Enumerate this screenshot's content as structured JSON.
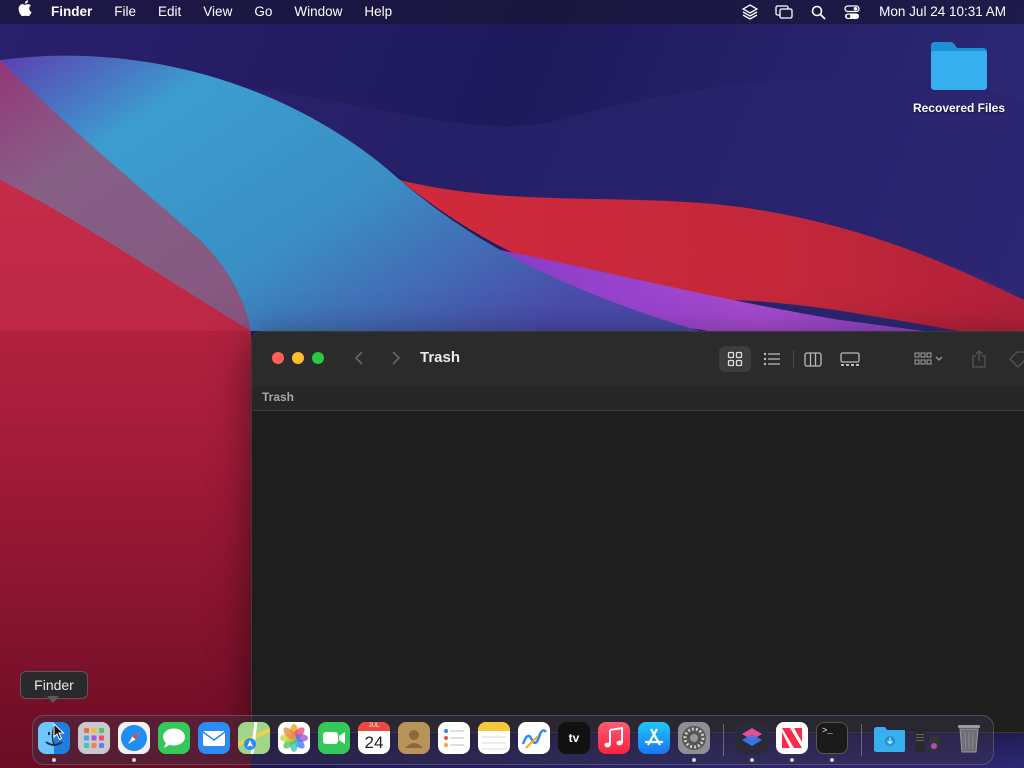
{
  "menubar": {
    "app_name": "Finder",
    "menus": [
      "File",
      "Edit",
      "View",
      "Go",
      "Window",
      "Help"
    ],
    "clock": "Mon Jul 24  10:31 AM",
    "status_icons": [
      "layers-icon",
      "screen-mirroring-icon",
      "search-icon",
      "control-center-icon"
    ]
  },
  "desktop": {
    "folder_label": "Recovered Files"
  },
  "finder_window": {
    "title": "Trash",
    "path_label": "Trash",
    "view_modes": [
      "icon-view",
      "list-view",
      "column-view",
      "gallery-view"
    ],
    "active_view": "icon-view"
  },
  "tooltip": {
    "text": "Finder"
  },
  "dock": {
    "apps": [
      {
        "name": "Finder",
        "running": true
      },
      {
        "name": "Launchpad",
        "running": false
      },
      {
        "name": "Safari",
        "running": true
      },
      {
        "name": "Messages",
        "running": false
      },
      {
        "name": "Mail",
        "running": false
      },
      {
        "name": "Maps",
        "running": false
      },
      {
        "name": "Photos",
        "running": false
      },
      {
        "name": "FaceTime",
        "running": false
      },
      {
        "name": "Calendar",
        "running": false
      },
      {
        "name": "Contacts",
        "running": false
      },
      {
        "name": "Reminders",
        "running": false
      },
      {
        "name": "Notes",
        "running": false
      },
      {
        "name": "Freeform",
        "running": false
      },
      {
        "name": "TV",
        "running": false
      },
      {
        "name": "Music",
        "running": false
      },
      {
        "name": "App Store",
        "running": false
      },
      {
        "name": "System Settings",
        "running": true
      },
      {
        "name": "Shortcuts",
        "running": true
      },
      {
        "name": "News",
        "running": true
      },
      {
        "name": "Terminal",
        "running": true
      },
      {
        "name": "Downloads",
        "running": false
      },
      {
        "name": "Recent Items",
        "running": false
      },
      {
        "name": "Trash",
        "running": false
      }
    ],
    "calendar_month": "JUL",
    "calendar_day": "24",
    "tv_label": "tv",
    "terminal_label": ">_"
  },
  "colors": {
    "finder_bg": "#1e1e1e",
    "toolbar_bg": "#2b2b2b",
    "close": "#ff5f57",
    "minimize": "#febc2e",
    "zoom": "#28c840"
  }
}
